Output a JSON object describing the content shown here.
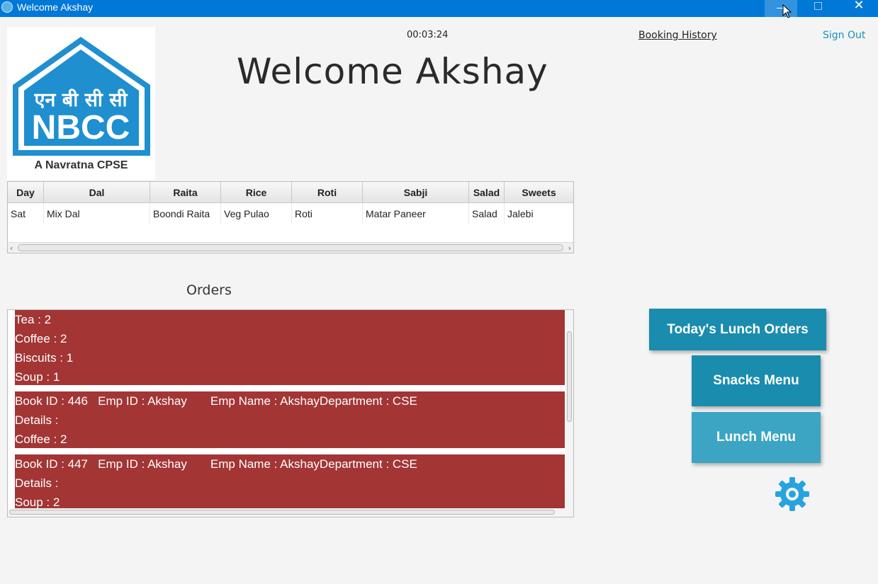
{
  "window": {
    "title": "Welcome Akshay"
  },
  "header": {
    "timer": "00:03:24",
    "booking_history": "Booking History",
    "sign_out": "Sign Out",
    "welcome": "Welcome Akshay"
  },
  "logo": {
    "hindi": "एन बी सी सी",
    "brand": "NBCC",
    "caption": "A Navratna CPSE"
  },
  "menu_table": {
    "columns": [
      "Day",
      "Dal",
      "Raita",
      "Rice",
      "Roti",
      "Sabji",
      "Salad",
      "Sweets"
    ],
    "rows": [
      [
        "Sat",
        "Mix Dal",
        "Boondi Raita",
        "Veg Pulao",
        "Roti",
        "Matar Paneer",
        "Salad",
        "Jalebi"
      ]
    ]
  },
  "orders": {
    "label": "Orders",
    "cards": [
      {
        "lines": [
          "Tea : 2",
          "Coffee : 2",
          "Biscuits : 1",
          "Soup : 1"
        ]
      },
      {
        "lines": [
          "Book ID : 446   Emp ID : Akshay       Emp Name : AkshayDepartment : CSE",
          "Details :",
          "Coffee : 2"
        ]
      },
      {
        "lines": [
          "Book ID : 447   Emp ID : Akshay       Emp Name : AkshayDepartment : CSE",
          "Details :",
          "Soup : 2"
        ]
      }
    ]
  },
  "buttons": {
    "todays_lunch_orders": "Today's Lunch Orders",
    "snacks_menu": "Snacks Menu",
    "lunch_menu": "Lunch Menu"
  },
  "colors": {
    "titlebar": "#0078d7",
    "order_card": "#a33535",
    "button_primary": "#1a8cae",
    "button_secondary": "#3ba5c3",
    "gear": "#27a3e0"
  },
  "icons": {
    "settings": "gear-icon",
    "app": "app-icon"
  }
}
